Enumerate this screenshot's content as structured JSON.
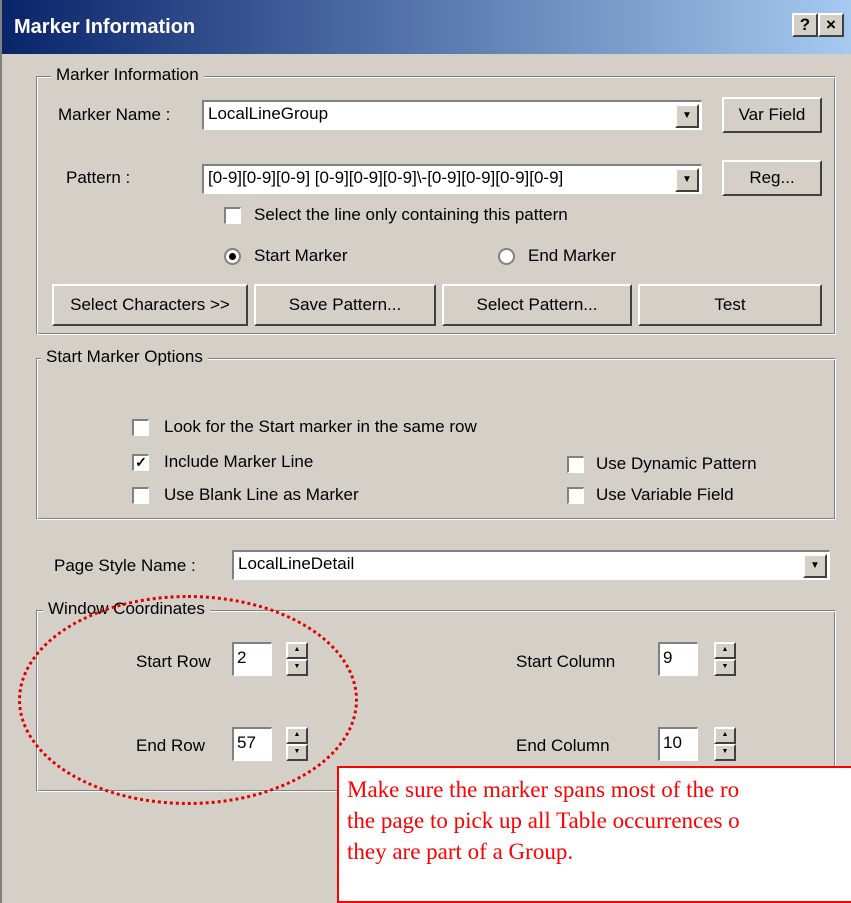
{
  "window": {
    "title": "Marker Information",
    "help_label": "?",
    "close_label": "×"
  },
  "marker_group": {
    "legend": "Marker Information",
    "name_label": "Marker Name  :",
    "name_value": "LocalLineGroup",
    "var_field_button": "Var Field",
    "pattern_label": "Pattern  :",
    "pattern_value": "[0-9][0-9][0-9] [0-9][0-9][0-9]\\-[0-9][0-9][0-9][0-9]",
    "reg_button": "Reg...",
    "select_line_label": "Select the line only containing this pattern",
    "select_line_checked": false,
    "start_marker_label": "Start Marker",
    "end_marker_label": "End Marker",
    "selected_marker": "Start Marker",
    "select_characters_button": "Select Characters >>",
    "save_pattern_button": "Save Pattern...",
    "select_pattern_button": "Select Pattern...",
    "test_button": "Test"
  },
  "start_options": {
    "legend": "Start Marker Options",
    "look_same_row_label": "Look for the Start marker in the same row",
    "look_same_row_checked": false,
    "include_marker_line_label": "Include Marker Line",
    "include_marker_line_checked": true,
    "blank_line_label": "Use Blank Line as Marker",
    "blank_line_checked": false,
    "dynamic_pattern_label": "Use Dynamic Pattern",
    "dynamic_pattern_checked": false,
    "variable_field_label": "Use Variable Field",
    "variable_field_checked": false
  },
  "page_style": {
    "label": "Page Style Name :",
    "value": "LocalLineDetail"
  },
  "coords": {
    "legend": "Window Coordinates",
    "start_row_label": "Start Row",
    "start_row_value": "2",
    "end_row_label": "End Row",
    "end_row_value": "57",
    "start_col_label": "Start Column",
    "start_col_value": "9",
    "end_col_label": "End Column",
    "end_col_value": "10"
  },
  "callout": {
    "line1": "Make sure the marker spans most of the ro",
    "line2": "the page to pick up all Table occurrences o",
    "line3": "they are part of a Group."
  },
  "colors": {
    "title_bar_start": "#0a246a",
    "title_bar_end": "#a6caf0",
    "dialog_face": "#d4d0c8",
    "annotation_red": "#ff0000"
  },
  "icons": {
    "dropdown": "chevron-down-icon",
    "spin_up": "spin-up-icon",
    "spin_down": "spin-down-icon",
    "check": "check-icon"
  }
}
